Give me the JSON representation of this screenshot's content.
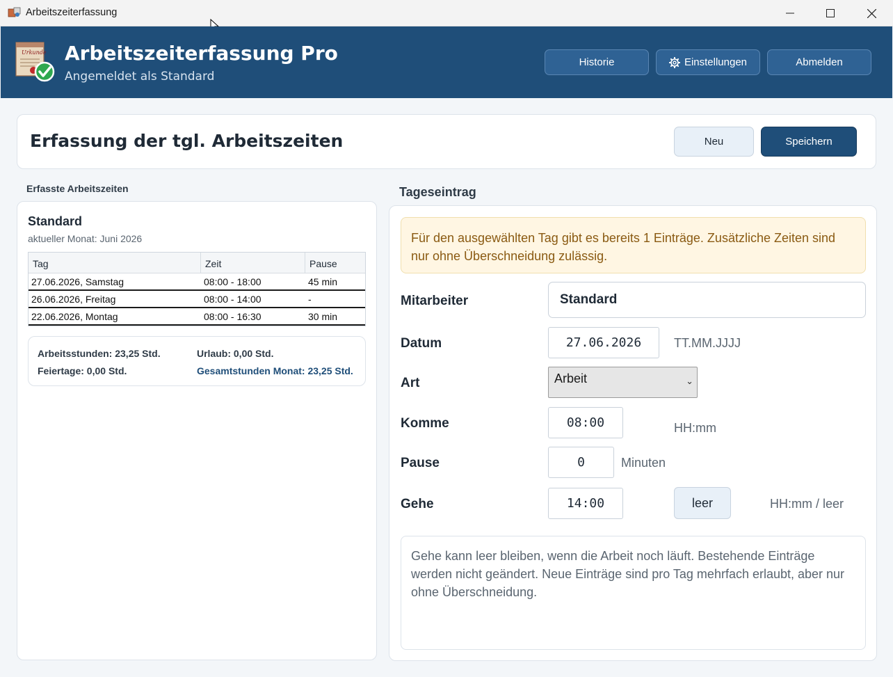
{
  "window": {
    "title": "Arbeitszeiterfassung"
  },
  "header": {
    "app_name": "Arbeitszeiterfassung Pro",
    "logged_in": "Angemeldet als Standard",
    "buttons": {
      "history": "Historie",
      "settings": "Einstellungen",
      "logout": "Abmelden"
    },
    "colors": {
      "bg": "#1f4e79",
      "button": "#2f6294"
    }
  },
  "page": {
    "title": "Erfassung der tgl. Arbeitszeiten",
    "new_label": "Neu",
    "save_label": "Speichern"
  },
  "left": {
    "section_label": "Erfasste Arbeitszeiten",
    "employee": "Standard",
    "month": "aktueller Monat: Juni 2026",
    "columns": [
      "Tag",
      "Zeit",
      "Pause"
    ],
    "rows": [
      [
        "27.06.2026, Samstag",
        "08:00 - 18:00",
        "45 min"
      ],
      [
        "26.06.2026, Freitag",
        "08:00 - 14:00",
        "-"
      ],
      [
        "22.06.2026, Montag",
        "08:00 - 16:30",
        "30 min"
      ]
    ],
    "summary": {
      "work_hours": "Arbeitsstunden: 23,25 Std.",
      "vacation": "Urlaub: 0,00 Std.",
      "holidays": "Feiertage: 0,00 Std.",
      "total": "Gesamtstunden Monat: 23,25 Std."
    }
  },
  "right": {
    "section_label": "Tageseintrag",
    "notice": "Für den ausgewählten Tag gibt es bereits 1 Einträge. Zusätzliche Zeiten sind nur ohne Überschneidung zulässig.",
    "fields": {
      "employee_label": "Mitarbeiter",
      "employee_value": "Standard",
      "date_label": "Datum",
      "date_value": "27.06.2026",
      "date_hint": "TT.MM.JJJJ",
      "type_label": "Art",
      "type_value": "Arbeit",
      "come_label": "Komme",
      "come_value": "08:00",
      "come_hint": "HH:mm",
      "pause_label": "Pause",
      "pause_value": "0",
      "pause_hint": "Minuten",
      "go_label": "Gehe",
      "go_value": "14:00",
      "go_clear": "leer",
      "go_hint": "HH:mm / leer"
    },
    "info": "Gehe kann leer bleiben, wenn die Arbeit noch läuft. Bestehende Einträge werden nicht geändert. Neue Einträge sind pro Tag mehrfach erlaubt, aber nur ohne Überschneidung.",
    "colors": {
      "notice_bg": "#fff6e3",
      "notice_text": "#8a5a12"
    }
  },
  "icons": {
    "app": "app-icon",
    "logo": "certificate-check-icon",
    "settings": "gear-icon",
    "minimize": "minimize-icon",
    "maximize": "maximize-icon",
    "close": "close-icon",
    "select": "chevron-down-icon"
  }
}
